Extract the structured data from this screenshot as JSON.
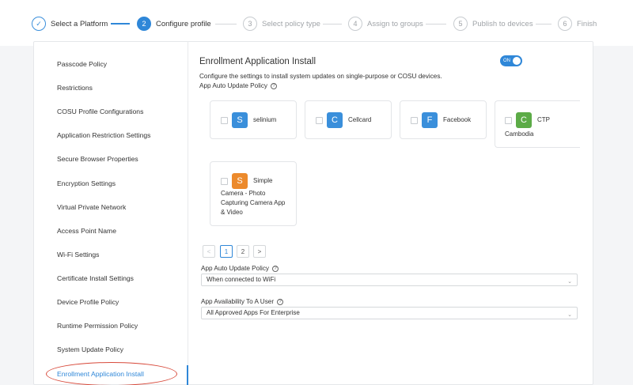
{
  "stepper": {
    "steps": [
      {
        "num": "✓",
        "label": "Select a Platform"
      },
      {
        "num": "2",
        "label": "Configure profile"
      },
      {
        "num": "3",
        "label": "Select policy type"
      },
      {
        "num": "4",
        "label": "Assign to groups"
      },
      {
        "num": "5",
        "label": "Publish to devices"
      },
      {
        "num": "6",
        "label": "Finish"
      }
    ]
  },
  "sidebar": {
    "items": [
      {
        "label": "Passcode Policy"
      },
      {
        "label": "Restrictions"
      },
      {
        "label": "COSU Profile Configurations"
      },
      {
        "label": "Application Restriction Settings"
      },
      {
        "label": "Secure Browser Properties"
      },
      {
        "label": "Encryption Settings"
      },
      {
        "label": "Virtual Private Network"
      },
      {
        "label": "Access Point Name"
      },
      {
        "label": "Wi-Fi Settings"
      },
      {
        "label": "Certificate Install Settings"
      },
      {
        "label": "Device Profile Policy"
      },
      {
        "label": "Runtime Permission Policy"
      },
      {
        "label": "System Update Policy"
      },
      {
        "label": "Enrollment Application Install"
      }
    ]
  },
  "content": {
    "title": "Enrollment Application Install",
    "toggle": "ON",
    "description": "Configure the settings to install system updates on single-purpose or COSU devices.",
    "auto_update_label": "App Auto Update Policy",
    "help_glyph": "?",
    "apps": [
      {
        "icon_letter": "S",
        "name": "selinium",
        "color": "#3a8fdb"
      },
      {
        "icon_letter": "C",
        "name": "Cellcard",
        "color": "#3a8fdb"
      },
      {
        "icon_letter": "F",
        "name": "Facebook",
        "color": "#3a8fdb"
      },
      {
        "icon_letter": "C",
        "name_line1": "CTP",
        "name_line2": "Cambodia",
        "color": "#5cab47"
      },
      {
        "icon_letter": "S",
        "name_line1": "Simple",
        "name_line2": "Camera - Photo",
        "name_line3": "Capturing Camera App",
        "name_line4": "& Video",
        "color": "#ec8a2c"
      }
    ],
    "pager": {
      "prev": "<",
      "pages": [
        "1",
        "2"
      ],
      "next": ">"
    },
    "auto_update_policy": {
      "label": "App Auto Update Policy",
      "value": "When connected to WiFi"
    },
    "availability": {
      "label": "App Availability To A User",
      "value": "All Approved Apps For Enterprise"
    },
    "caret": "⌄"
  },
  "colors": {
    "accent": "#2f87d8",
    "highlight": "#d84a3b"
  }
}
